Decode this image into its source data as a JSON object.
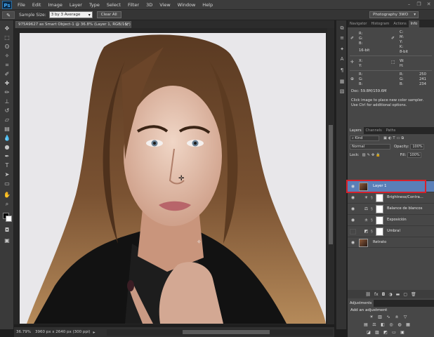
{
  "app": {
    "logo": "Ps"
  },
  "menu": [
    "File",
    "Edit",
    "Image",
    "Layer",
    "Type",
    "Select",
    "Filter",
    "3D",
    "View",
    "Window",
    "Help"
  ],
  "options_bar": {
    "sample_size_label": "Sample Size:",
    "sample_size_value": "3 by 3 Average",
    "clear_all": "Clear All",
    "workspace": "Photography 3WO"
  },
  "document": {
    "tab_title": "975A9627 as Smart Object-1 @ 36.8% (Layer 1, RGB/16*) *",
    "zoom": "36.79%",
    "size_info": "3960 px x 2640 px (300 ppi)"
  },
  "panels": {
    "top_tabs": [
      "Navigator",
      "Histogram",
      "Actions",
      "Info"
    ],
    "info": {
      "r": "R:",
      "g": "G:",
      "b": "B:",
      "c": "C:",
      "m": "M:",
      "y": "Y:",
      "k": "K:",
      "bit_left": "16-bit",
      "bit_right": "8-bit",
      "x": "X:",
      "y_coord": "Y:",
      "w": "W:",
      "h": "H:",
      "sample_values": [
        "250",
        "241",
        "234"
      ],
      "doc": "Doc: 59.8M/159.6M",
      "tip": "Click image to place new color sampler.  Use Ctrl for additional options."
    },
    "layer_tabs": [
      "Layers",
      "Channels",
      "Paths"
    ],
    "layers": {
      "kind": "⌕ Kind",
      "blend_mode": "Normal",
      "opacity_label": "Opacity:",
      "opacity": "100%",
      "lock_label": "Lock:",
      "fill_label": "Fill:",
      "fill": "100%",
      "items": [
        {
          "name": "Layer 1",
          "type": "smart",
          "visible": true,
          "active": true
        },
        {
          "name": "Brightness/Contra...",
          "type": "adjustment",
          "visible": true
        },
        {
          "name": "Balance de blancos",
          "type": "adjustment",
          "visible": true
        },
        {
          "name": "Exposición",
          "type": "adjustment",
          "visible": true
        },
        {
          "name": "Umbral",
          "type": "adjustment",
          "visible": false
        },
        {
          "name": "Retrato",
          "type": "image",
          "visible": true
        }
      ]
    },
    "adjustments": {
      "tab": "Adjustments",
      "title": "Add an adjustment"
    }
  },
  "colors": {
    "active_layer": "#5a7fb8",
    "highlight": "#d8202a",
    "accent": "#41a8f5"
  }
}
